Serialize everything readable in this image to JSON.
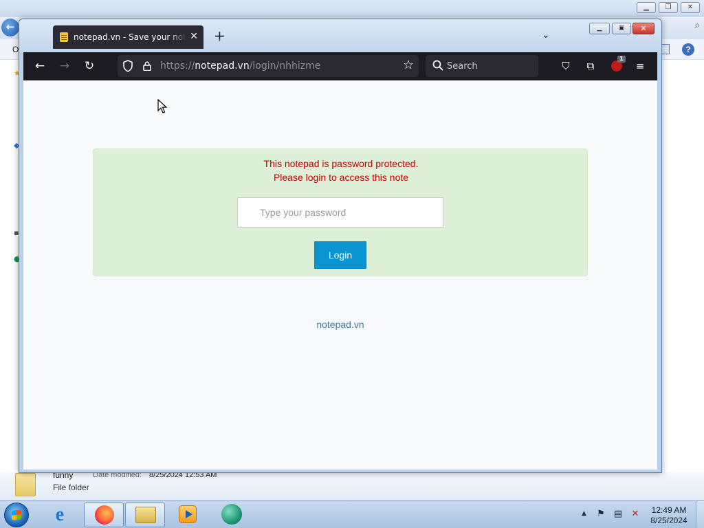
{
  "explorer": {
    "menu_fragment": "O",
    "file_name": "funny",
    "date_modified_label": "Date modified:",
    "date_modified_value": "8/25/2024 12:53 AM",
    "file_type": "File folder"
  },
  "browser": {
    "tab": {
      "title": "notepad.vn - Save your notes, Share your notes"
    },
    "url": {
      "scheme": "https://",
      "host": "notepad.vn",
      "path": "/login/nhhizme"
    },
    "search": {
      "label": "Search"
    },
    "extension_badge": "1"
  },
  "page": {
    "message_line1": "This notepad is password protected.",
    "message_line2": "Please login to access this note",
    "password_placeholder": "Type your password",
    "login_label": "Login",
    "site_link": "notepad.vn"
  },
  "taskbar": {
    "time": "12:49 AM",
    "date": "8/25/2024"
  },
  "colors": {
    "alert_bg": "#dff0d8",
    "alert_text": "#c00000",
    "button_bg": "#0a95d0",
    "link": "#3a7ca5",
    "toolbar_bg": "#1c1b22"
  }
}
